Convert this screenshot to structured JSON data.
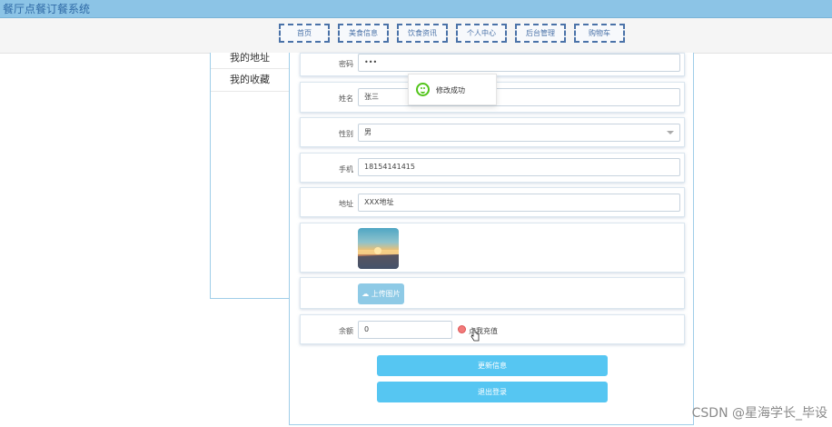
{
  "app": {
    "title": "餐厅点餐订餐系统"
  },
  "nav": [
    {
      "label": "首页"
    },
    {
      "label": "美食信息"
    },
    {
      "label": "饮食资讯"
    },
    {
      "label": "个人中心"
    },
    {
      "label": "后台管理"
    },
    {
      "label": "购物车"
    }
  ],
  "sidebar": {
    "items": [
      {
        "label": "我的地址"
      },
      {
        "label": "我的收藏"
      }
    ]
  },
  "toast": {
    "message": "修改成功"
  },
  "form": {
    "password": {
      "label": "密码",
      "value": "•••"
    },
    "name": {
      "label": "姓名",
      "value": "张三"
    },
    "gender": {
      "label": "性别",
      "value": "男"
    },
    "phone": {
      "label": "手机",
      "value": "18154141415"
    },
    "address": {
      "label": "地址",
      "value": "XXX地址"
    },
    "upload_label": "上传图片",
    "balance": {
      "label": "余额",
      "value": "0",
      "recharge": "点我充值"
    }
  },
  "buttons": {
    "update": "更新信息",
    "logout": "退出登录"
  },
  "watermark": "CSDN @星海学长_毕设",
  "colors": {
    "topbar": "#8cc4e6",
    "nav_border": "#4a72a8",
    "primary_button": "#56c6f2",
    "upload_button": "#8ecae6",
    "success": "#52c41a"
  }
}
